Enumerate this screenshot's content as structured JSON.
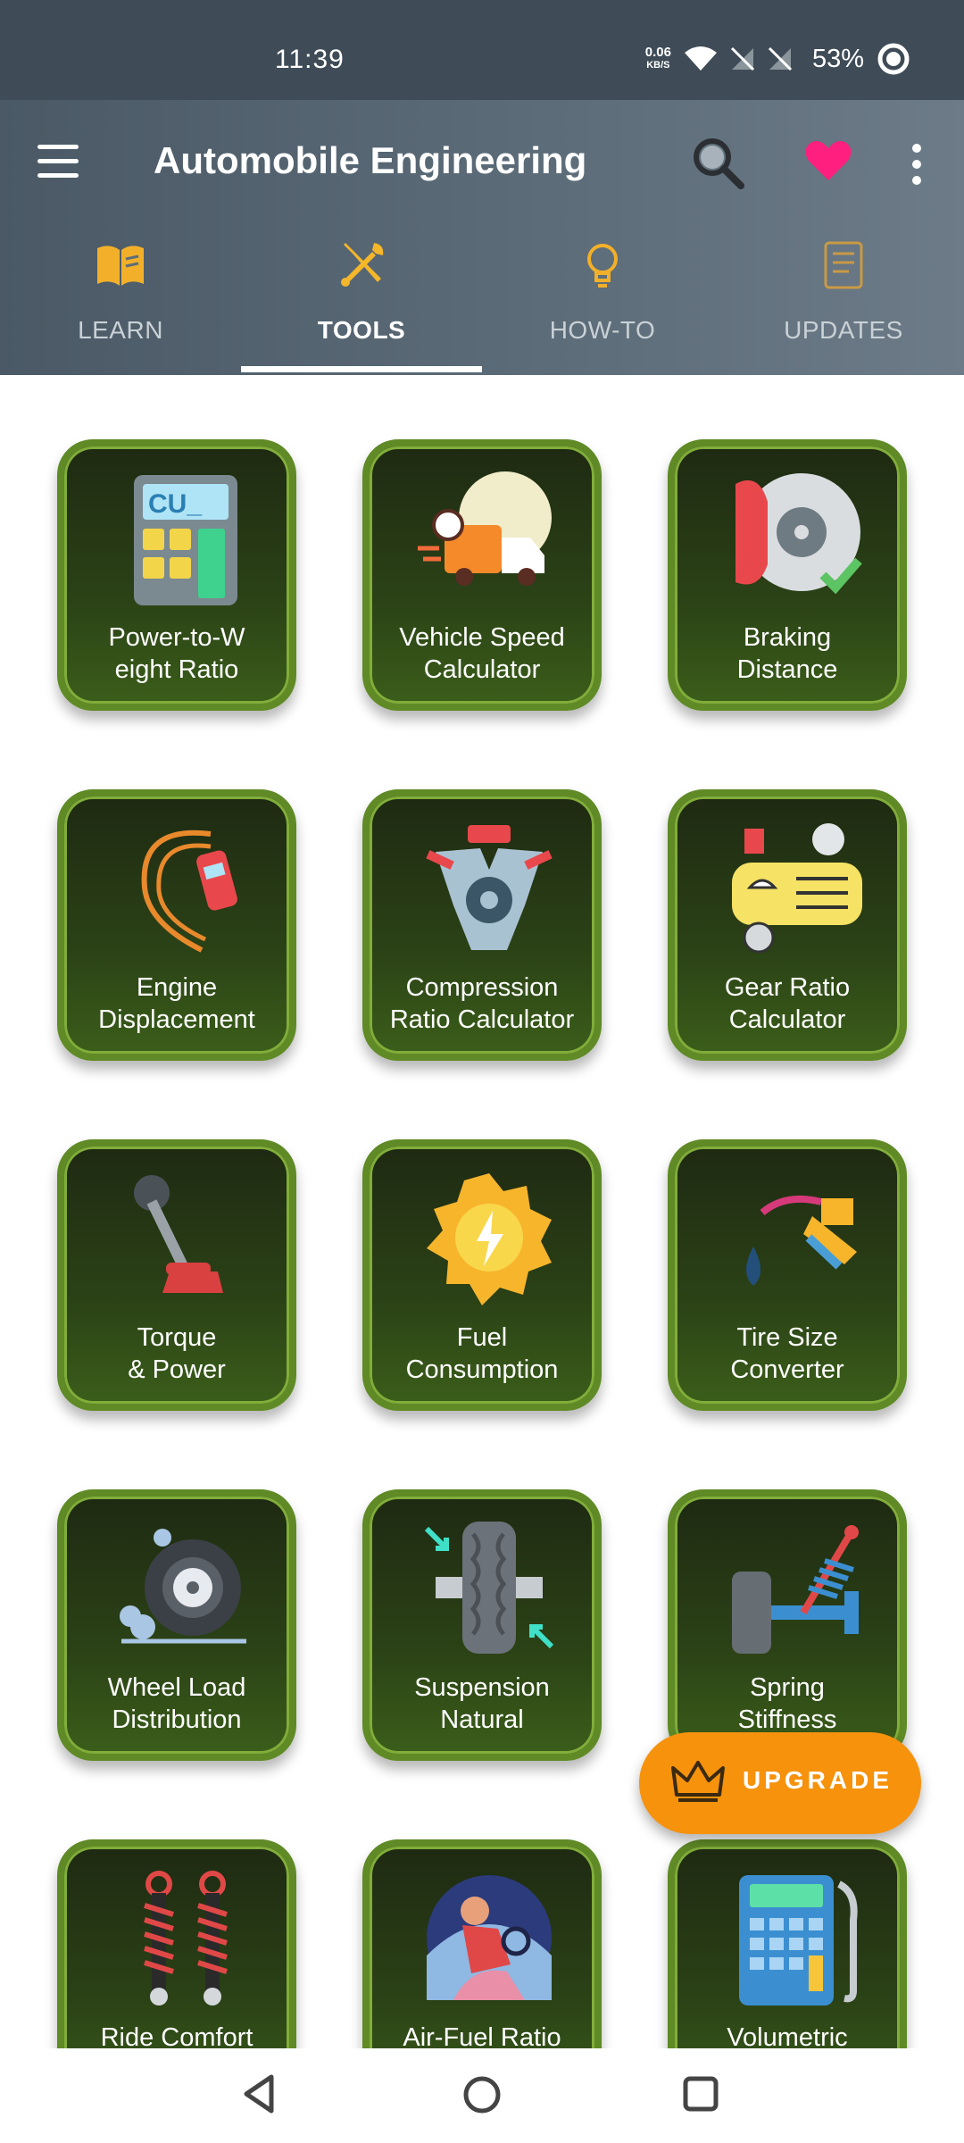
{
  "status": {
    "time": "11:39",
    "net_speed_value": "0.06",
    "net_speed_unit": "KB/S",
    "battery": "53%"
  },
  "appbar": {
    "title": "Automobile Engineering",
    "icons": [
      "menu-icon",
      "search-icon",
      "heart-icon",
      "more-vert-icon"
    ],
    "heart_color": "#ff1f7e"
  },
  "tabs": [
    {
      "label": "LEARN",
      "icon": "book-icon",
      "active": false
    },
    {
      "label": "TOOLS",
      "icon": "tools-icon",
      "active": true
    },
    {
      "label": "HOW-TO",
      "icon": "lightbulb-icon",
      "active": false
    },
    {
      "label": "UPDATES",
      "icon": "news-icon",
      "active": false
    }
  ],
  "tools": [
    {
      "label1": "Power-to-W",
      "label2": "eight Ratio",
      "icon": "calculator-icon"
    },
    {
      "label1": "Vehicle Speed",
      "label2": "Calculator",
      "icon": "delivery-truck-icon"
    },
    {
      "label1": "Braking",
      "label2": "Distance",
      "icon": "brake-disc-icon"
    },
    {
      "label1": "Engine",
      "label2": "Displacement",
      "icon": "drifting-car-icon"
    },
    {
      "label1": "Compression",
      "label2": "Ratio Calculator",
      "icon": "engine-block-icon"
    },
    {
      "label1": "Gear Ratio",
      "label2": "Calculator",
      "icon": "air-compressor-icon"
    },
    {
      "label1": "Torque",
      "label2": "& Power",
      "icon": "gear-shifter-icon"
    },
    {
      "label1": "Fuel",
      "label2": "Consumption",
      "icon": "energy-badge-icon"
    },
    {
      "label1": "Tire Size",
      "label2": "Converter",
      "icon": "fuel-nozzle-icon"
    },
    {
      "label1": "Wheel Load",
      "label2": "Distribution",
      "icon": "spinning-wheel-icon"
    },
    {
      "label1": "Suspension",
      "label2": "Natural",
      "icon": "tire-tread-icon"
    },
    {
      "label1": "Spring",
      "label2": "Stiffness",
      "icon": "shock-absorber-icon"
    },
    {
      "label1": "Ride Comfort",
      "label2": "",
      "icon": "coil-springs-icon"
    },
    {
      "label1": "Air-Fuel Ratio",
      "label2": "",
      "icon": "driver-icon"
    },
    {
      "label1": "Volumetric",
      "label2": "",
      "icon": "fuel-calculator-icon"
    }
  ],
  "upgrade": {
    "label": "UPGRADE",
    "icon": "crown-icon"
  },
  "colors": {
    "status_bar": "#3f4c57",
    "appbar": "#5d6d79",
    "tab_accent": "#f4b62a",
    "tile_border": "#5f8a26",
    "tile_bg": "#2b4216",
    "upgrade": "#f6920c"
  },
  "nav": {
    "icons": [
      "back-icon",
      "home-icon",
      "recents-icon"
    ]
  }
}
